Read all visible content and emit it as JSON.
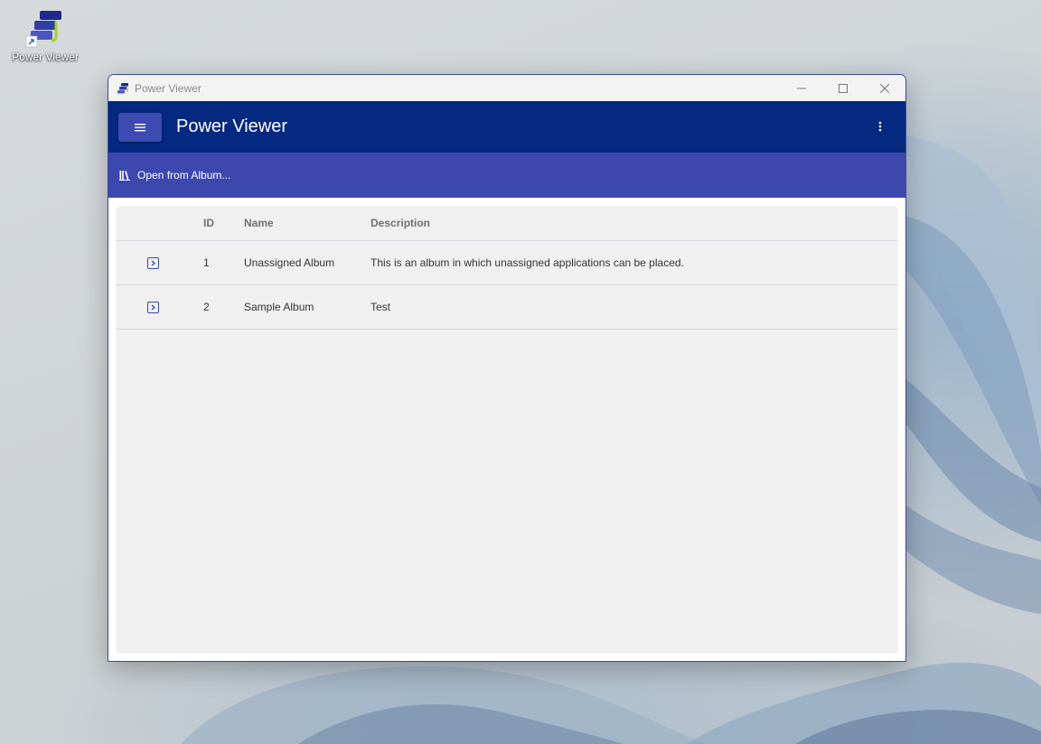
{
  "desktop": {
    "icon_label": "Power Viewer"
  },
  "window": {
    "title": "Power Viewer",
    "controls": [
      "minimize-icon",
      "maximize-icon",
      "close-icon"
    ]
  },
  "appbar": {
    "title": "Power Viewer",
    "menu_icon": "hamburger-icon",
    "more_icon": "more-vert-icon"
  },
  "toolbar": {
    "open_album_label": "Open from Album...",
    "open_album_icon": "library-icon"
  },
  "table": {
    "columns": [
      "ID",
      "Name",
      "Description"
    ],
    "rows": [
      {
        "id": "1",
        "name": "Unassigned Album",
        "description": "This is an album in which unassigned applications can be placed."
      },
      {
        "id": "2",
        "name": "Sample Album",
        "description": "Test"
      }
    ]
  },
  "colors": {
    "appbar": "#052880",
    "toolbar": "#3c48ae",
    "accent": "#3d4ab2"
  }
}
